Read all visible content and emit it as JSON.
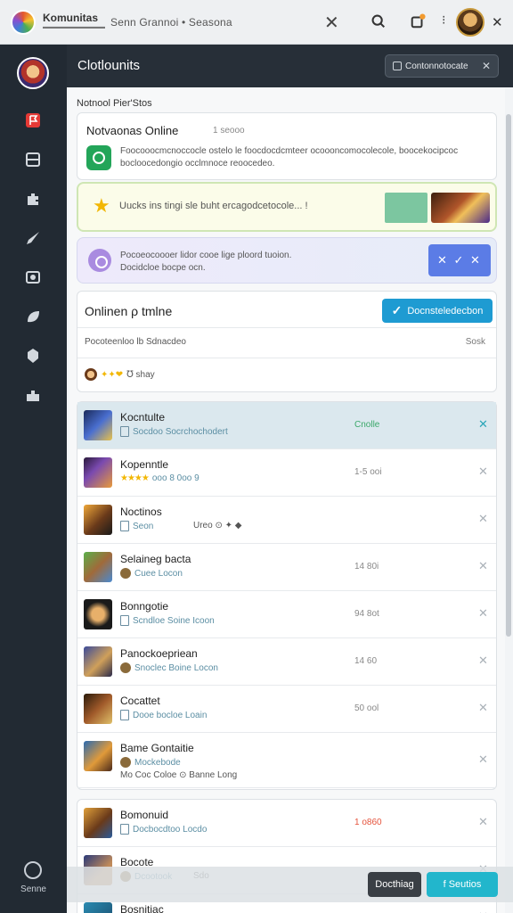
{
  "topbar": {
    "brand": "Komunitas",
    "breadcrumb": "Senn Grannoi • Seasona",
    "icons": [
      "close-icon",
      "search-icon",
      "notification-icon",
      "more-icon",
      "close-icon"
    ]
  },
  "sidebar": {
    "items": [
      {
        "name": "flag",
        "icon": "flag-icon",
        "active": true
      },
      {
        "name": "inbox",
        "icon": "inbox-icon"
      },
      {
        "name": "puzzle",
        "icon": "puzzle-icon"
      },
      {
        "name": "rocket",
        "icon": "rocket-icon"
      },
      {
        "name": "photo",
        "icon": "photo-icon"
      },
      {
        "name": "leaf",
        "icon": "leaf-icon"
      },
      {
        "name": "badge",
        "icon": "badge-icon"
      },
      {
        "name": "home",
        "icon": "home-icon"
      }
    ],
    "bottom_label": "Senne"
  },
  "header": {
    "title": "Clotlounits",
    "pill_label": "Contonnotocate"
  },
  "notice": {
    "heading": "Notnool Pier'Stos",
    "title": "Notvaonas Online",
    "meta": "1 seooo",
    "text": "Foocooocmcnoccocle ostelo le foocdocdcmteer ocoooncomocolecole, boocekocipcoc bocloocedongio occlmnoce reoocedeo."
  },
  "banner_green": {
    "text": "Uucks ins tingi sle buht ercagodcetocole... !"
  },
  "banner_purple": {
    "line1": "Pocoeocoooer lidor cooe lige ploord tuoion.",
    "line2": "Docidcloe bocpe ocn.",
    "button": "✕ ✓ ✕"
  },
  "online": {
    "title": "Onlinen ρ tmlne",
    "button_label": "Docnsteledecbon",
    "subtitle": "Pocoteenloo lb Sdnacdeo",
    "sort": "Sosk",
    "footer_text": "℧ shay"
  },
  "list": [
    {
      "name": "Kocntulte",
      "sub": "Socdoo Socrchochodert",
      "time": "Cnolle",
      "time_style": "green",
      "active": true,
      "thumb": "g1"
    },
    {
      "name": "Kopenntle",
      "sub": "ooo 8 0oo 9",
      "time": "1-5 ooi",
      "stars": "★★★★",
      "thumb": "g2"
    },
    {
      "name": "Noctinos",
      "sub": "Seon",
      "sub2": "Ureo ⊙ ✦ ◆",
      "time": "",
      "thumb": "g3"
    },
    {
      "name": "Selaineg bacta",
      "sub": "Cuee Locon",
      "time": "14 80i",
      "thumb": "g4"
    },
    {
      "name": "Bonngotie",
      "sub": "Scndloe Soine Icoon",
      "time": "94 8ot",
      "thumb": "g5"
    },
    {
      "name": "Panockoepriean",
      "sub": "Snoclec Boine Locon",
      "time": "14 60",
      "thumb": "g6"
    },
    {
      "name": "Cocattet",
      "sub": "Dooe bocloe Loain",
      "time": "50 ool",
      "thumb": "g7"
    },
    {
      "name": "Bame Gontaitie",
      "sub": "Mockebode",
      "sub2": "Mo Coc Coloe ⊙ Banne Long",
      "time": "",
      "tall": true,
      "thumb": "g8"
    }
  ],
  "list2": [
    {
      "name": "Bomonuid",
      "sub": "Docbocdtoo Locdo",
      "time": "1 о860",
      "time_style": "red",
      "thumb": "g9"
    },
    {
      "name": "Bocote",
      "sub": "Dcootook",
      "sub2": "Sdo",
      "time": "",
      "thumb": "g10"
    },
    {
      "name": "Bosnitiac",
      "sub": "",
      "time": "",
      "thumb": "g11"
    }
  ],
  "bottom": {
    "dark_button": "Docthiag",
    "teal_button": "f Seutios"
  },
  "colors": {
    "sidebar_bg": "#222a33",
    "accent_teal": "#22b6cc",
    "accent_blue": "#1e9bd2",
    "active_row": "#dbe8ee"
  }
}
